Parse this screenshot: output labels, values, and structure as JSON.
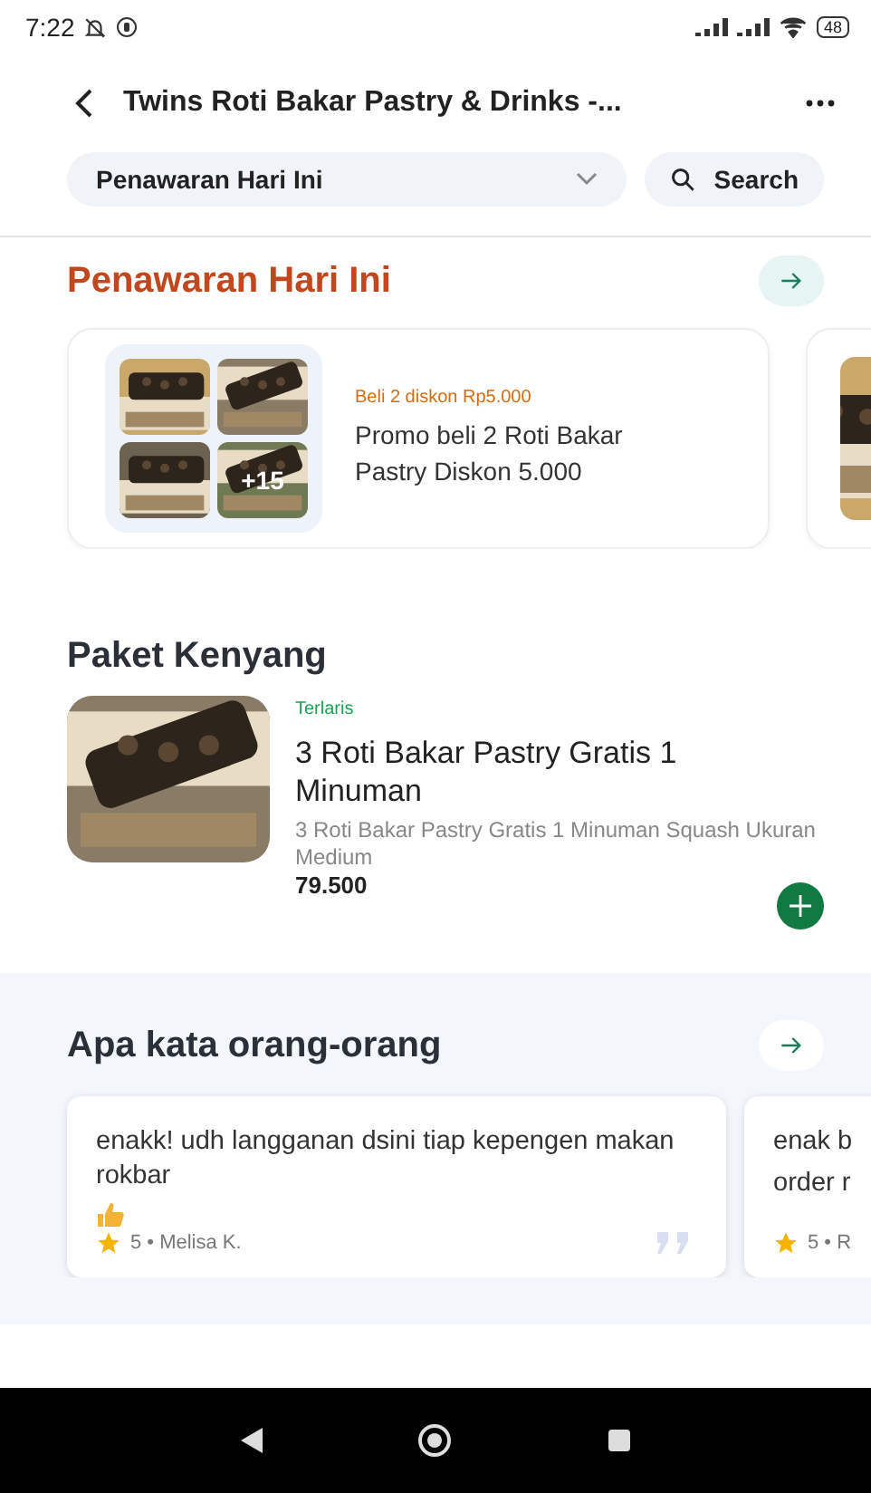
{
  "status_bar": {
    "time": "7:22",
    "battery": "48"
  },
  "header": {
    "title": "Twins Roti Bakar Pastry & Drinks -..."
  },
  "filter": {
    "category": "Penawaran Hari Ini",
    "search_label": "Search"
  },
  "offers": {
    "title": "Penawaran Hari Ini",
    "cards": [
      {
        "kind": "promo",
        "tag": "Beli 2 diskon Rp5.000",
        "name": "Promo beli 2 Roti Bakar Pastry Diskon 5.000",
        "more_count": "+15"
      },
      {
        "kind": "partial"
      }
    ]
  },
  "packages": {
    "title": "Paket Kenyang",
    "items": [
      {
        "badge": "Terlaris",
        "name": "3 Roti Bakar Pastry Gratis 1 Minuman",
        "description": "3 Roti Bakar Pastry Gratis 1 Minuman Squash Ukuran Medium",
        "price": "79.500"
      }
    ]
  },
  "reviews": {
    "title": "Apa kata orang-orang",
    "items": [
      {
        "kind": "full",
        "lines": [
          "enakk! udh langganan dsini tiap kepengen makan rokbar"
        ],
        "meta": "5 • Melisa K."
      },
      {
        "kind": "partial",
        "lines": [
          "enak b",
          "order r"
        ],
        "meta": "5 • R"
      }
    ]
  }
}
